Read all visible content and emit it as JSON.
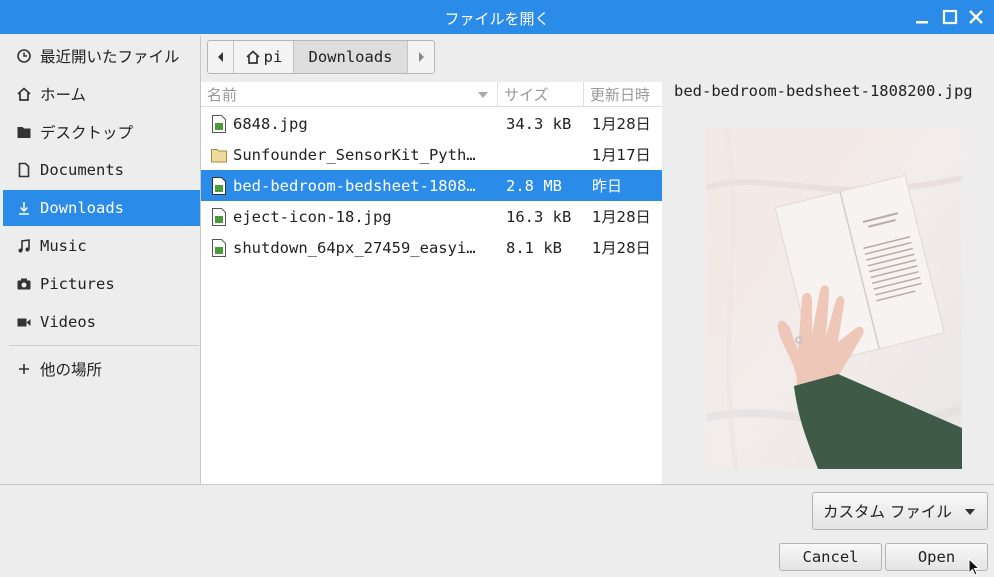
{
  "window": {
    "title": "ファイルを開く"
  },
  "sidebar": {
    "items": [
      {
        "label": "最近開いたファイル",
        "icon": "clock-icon"
      },
      {
        "label": "ホーム",
        "icon": "home-icon"
      },
      {
        "label": "デスクトップ",
        "icon": "folder-icon"
      },
      {
        "label": "Documents",
        "icon": "document-icon"
      },
      {
        "label": "Downloads",
        "icon": "download-icon",
        "selected": true
      },
      {
        "label": "Music",
        "icon": "music-icon"
      },
      {
        "label": "Pictures",
        "icon": "camera-icon"
      },
      {
        "label": "Videos",
        "icon": "video-icon"
      }
    ],
    "other_locations": {
      "label": "他の場所",
      "icon": "plus-icon"
    }
  },
  "pathbar": {
    "segments": [
      {
        "label": "pi",
        "icon": "home-icon"
      },
      {
        "label": "Downloads"
      }
    ]
  },
  "filelist": {
    "headers": {
      "name": "名前",
      "size": "サイズ",
      "modified": "更新日時"
    },
    "rows": [
      {
        "name": "6848.jpg",
        "size": "34.3 kB",
        "modified": "1月28日",
        "icon": "image-file-icon"
      },
      {
        "name": "Sunfounder_SensorKit_Pyth…",
        "size": "",
        "modified": "1月17日",
        "icon": "folder-icon"
      },
      {
        "name": "bed-bedroom-bedsheet-1808…",
        "size": "2.8 MB",
        "modified": "昨日",
        "icon": "image-file-icon",
        "selected": true
      },
      {
        "name": "eject-icon-18.jpg",
        "size": "16.3 kB",
        "modified": "1月28日",
        "icon": "image-file-icon"
      },
      {
        "name": "shutdown_64px_27459_easyi…",
        "size": "8.1 kB",
        "modified": "1月28日",
        "icon": "image-file-icon"
      }
    ]
  },
  "preview": {
    "filename": "bed-bedroom-bedsheet-1808200.jpg"
  },
  "bottom": {
    "filter_label": "カスタム ファイル",
    "cancel_label": "Cancel",
    "open_label": "Open"
  },
  "colors": {
    "accent": "#2a8ce8"
  }
}
